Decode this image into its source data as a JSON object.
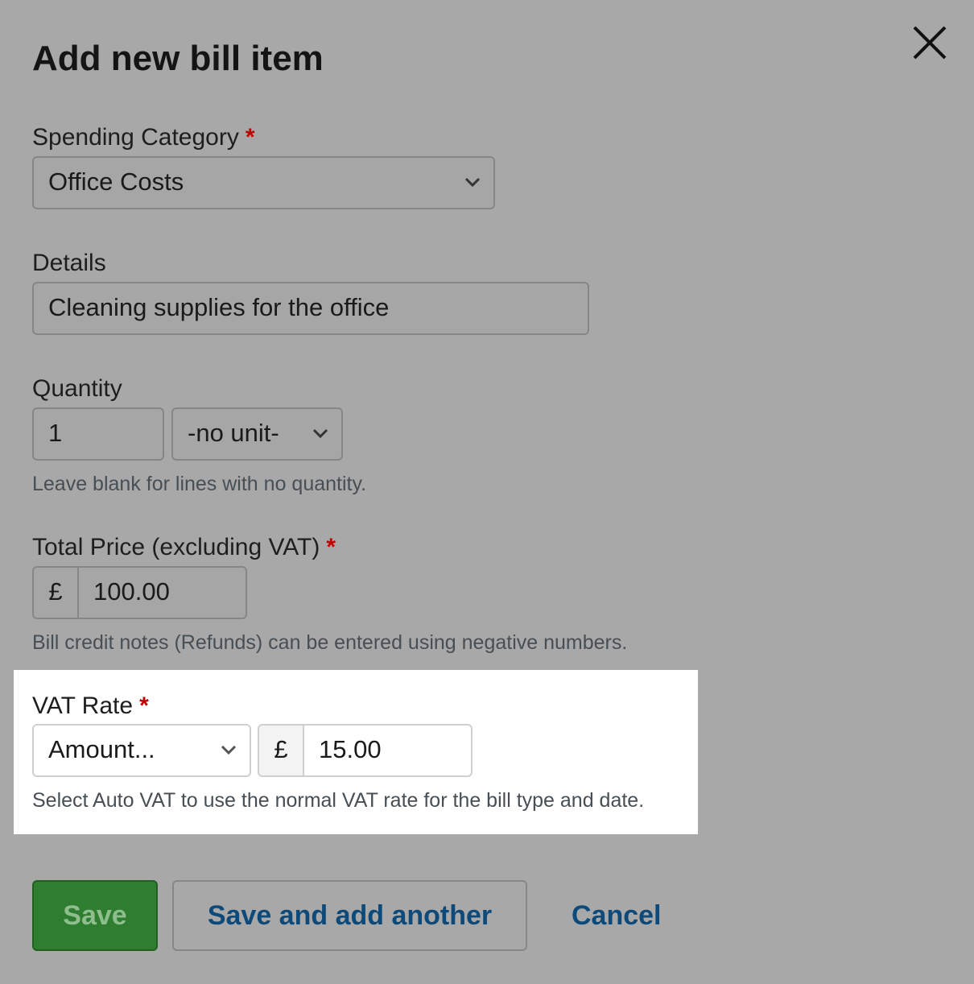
{
  "dialog": {
    "title": "Add new bill item"
  },
  "icons": {
    "close": "close-icon",
    "chevron": "chevron-down-icon"
  },
  "required_marker": "*",
  "colors": {
    "required": "#c00000",
    "save_button": "#2f7d2f",
    "link": "#0d4a79",
    "overlay": "#a8a8a8"
  },
  "spending_category": {
    "label": "Spending Category",
    "selected": "Office Costs"
  },
  "details": {
    "label": "Details",
    "value": "Cleaning supplies for the office"
  },
  "quantity": {
    "label": "Quantity",
    "value": "1",
    "unit": "-no unit-",
    "hint": "Leave blank for lines with no quantity."
  },
  "total_price": {
    "label": "Total Price (excluding VAT)",
    "currency": "£",
    "value": "100.00",
    "hint": "Bill credit notes (Refunds) can be entered using negative numbers."
  },
  "vat_rate": {
    "label": "VAT Rate",
    "selected": "Amount...",
    "currency": "£",
    "value": "15.00",
    "hint": "Select Auto VAT to use the normal VAT rate for the bill type and date."
  },
  "actions": {
    "save": "Save",
    "save_and_add_another": "Save and add another",
    "cancel": "Cancel"
  }
}
